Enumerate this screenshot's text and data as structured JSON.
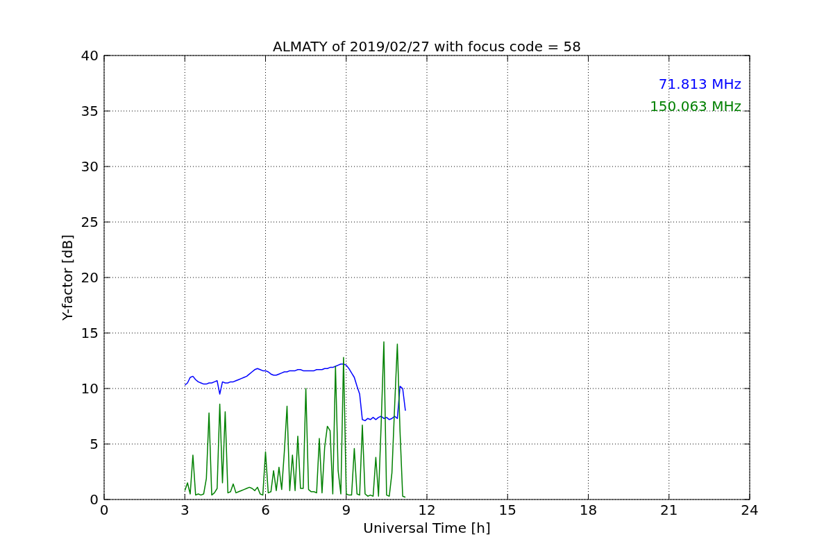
{
  "chart_data": {
    "type": "line",
    "title": "ALMATY of 2019/02/27 with focus code = 58",
    "xlabel": "Universal Time [h]",
    "ylabel": "Y-factor [dB]",
    "grid": true,
    "xlim": [
      0,
      24
    ],
    "ylim": [
      0,
      40
    ],
    "xticks": [
      0,
      3,
      6,
      9,
      12,
      15,
      18,
      21,
      24
    ],
    "yticks": [
      0,
      5,
      10,
      15,
      20,
      25,
      30,
      35,
      40
    ],
    "x": [
      3.0,
      3.1,
      3.2,
      3.3,
      3.4,
      3.5,
      3.6,
      3.7,
      3.8,
      3.9,
      4.0,
      4.1,
      4.2,
      4.3,
      4.4,
      4.5,
      4.6,
      4.7,
      4.8,
      4.9,
      5.0,
      5.1,
      5.2,
      5.3,
      5.4,
      5.5,
      5.6,
      5.7,
      5.8,
      5.9,
      6.0,
      6.1,
      6.2,
      6.3,
      6.4,
      6.5,
      6.6,
      6.7,
      6.8,
      6.9,
      7.0,
      7.1,
      7.2,
      7.3,
      7.4,
      7.5,
      7.6,
      7.7,
      7.8,
      7.9,
      8.0,
      8.1,
      8.2,
      8.3,
      8.4,
      8.5,
      8.6,
      8.7,
      8.8,
      8.9,
      9.0,
      9.1,
      9.2,
      9.3,
      9.4,
      9.5,
      9.6,
      9.7,
      9.8,
      9.9,
      10.0,
      10.1,
      10.2,
      10.3,
      10.4,
      10.5,
      10.6,
      10.7,
      10.8,
      10.9,
      11.0,
      11.1,
      11.2
    ],
    "series": [
      {
        "name": "71.813 MHz",
        "color": "#0000ff",
        "values": [
          10.3,
          10.5,
          11.0,
          11.1,
          10.8,
          10.6,
          10.5,
          10.4,
          10.4,
          10.5,
          10.5,
          10.6,
          10.7,
          9.5,
          10.6,
          10.5,
          10.5,
          10.6,
          10.6,
          10.7,
          10.8,
          10.9,
          11.0,
          11.1,
          11.3,
          11.5,
          11.7,
          11.8,
          11.7,
          11.6,
          11.6,
          11.5,
          11.3,
          11.2,
          11.2,
          11.3,
          11.4,
          11.5,
          11.5,
          11.6,
          11.6,
          11.6,
          11.7,
          11.7,
          11.6,
          11.6,
          11.6,
          11.6,
          11.6,
          11.7,
          11.7,
          11.7,
          11.8,
          11.8,
          11.9,
          11.9,
          12.0,
          12.1,
          12.2,
          12.2,
          12.1,
          11.8,
          11.4,
          11.0,
          10.2,
          9.5,
          7.2,
          7.1,
          7.3,
          7.2,
          7.4,
          7.2,
          7.4,
          7.5,
          7.3,
          7.4,
          7.2,
          7.3,
          7.5,
          7.3,
          10.2,
          10.0,
          8.0
        ]
      },
      {
        "name": "150.063 MHz",
        "color": "#008000",
        "values": [
          0.8,
          1.5,
          0.5,
          4.0,
          0.4,
          0.5,
          0.4,
          0.5,
          1.9,
          7.8,
          0.4,
          0.6,
          1.0,
          8.6,
          1.5,
          7.9,
          0.6,
          0.7,
          1.4,
          0.6,
          0.7,
          0.8,
          0.9,
          1.0,
          1.1,
          1.0,
          0.8,
          1.1,
          0.5,
          0.4,
          4.3,
          0.6,
          0.7,
          2.6,
          0.8,
          2.9,
          0.9,
          4.3,
          8.4,
          0.8,
          4.0,
          0.8,
          5.7,
          1.0,
          1.0,
          10.0,
          0.9,
          0.7,
          0.7,
          0.6,
          5.5,
          0.6,
          4.7,
          6.6,
          6.2,
          0.5,
          12.0,
          2.6,
          0.5,
          12.8,
          0.5,
          0.4,
          0.4,
          4.6,
          0.5,
          0.4,
          6.7,
          0.5,
          0.3,
          0.4,
          0.3,
          3.8,
          0.3,
          6.8,
          14.2,
          0.4,
          0.3,
          2.4,
          8.4,
          14.0,
          6.1,
          0.3,
          0.2
        ]
      }
    ]
  }
}
